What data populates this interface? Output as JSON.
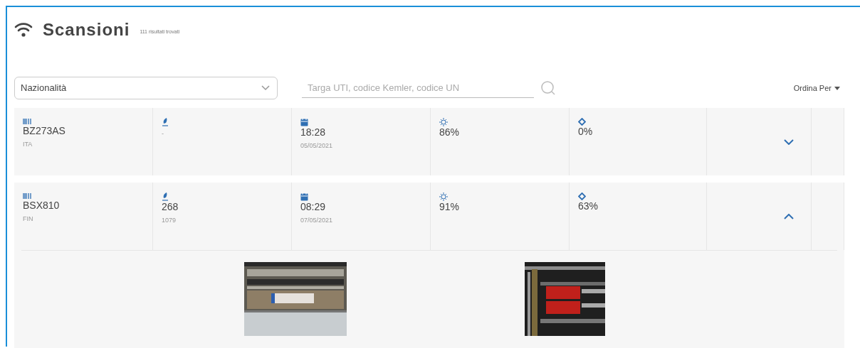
{
  "header": {
    "title": "Scansioni",
    "subtitle": "111 risultati trovati"
  },
  "filters": {
    "nationality": {
      "placeholder": "Nazionalità"
    },
    "search": {
      "placeholder": "Targa UTI, codice Kemler, codice UN"
    },
    "sort": {
      "label": "Ordina Per"
    }
  },
  "scans": [
    {
      "expanded": false,
      "cells": [
        {
          "kind": "plate",
          "value": "BZ273AS",
          "sub": "ITA"
        },
        {
          "kind": "hazard",
          "sub": "-"
        },
        {
          "kind": "date",
          "value": "18:28",
          "sub": "05/05/2021"
        },
        {
          "kind": "confidence",
          "value": "86%"
        },
        {
          "kind": "accuracy",
          "value": "0%"
        }
      ]
    },
    {
      "expanded": true,
      "cells": [
        {
          "kind": "plate",
          "value": "BSX810",
          "sub": "FIN"
        },
        {
          "kind": "hazard",
          "value": "268",
          "sub": "1079"
        },
        {
          "kind": "date",
          "value": "08:29",
          "sub": "07/05/2021"
        },
        {
          "kind": "confidence",
          "value": "91%"
        },
        {
          "kind": "accuracy",
          "value": "63%"
        }
      ]
    }
  ]
}
